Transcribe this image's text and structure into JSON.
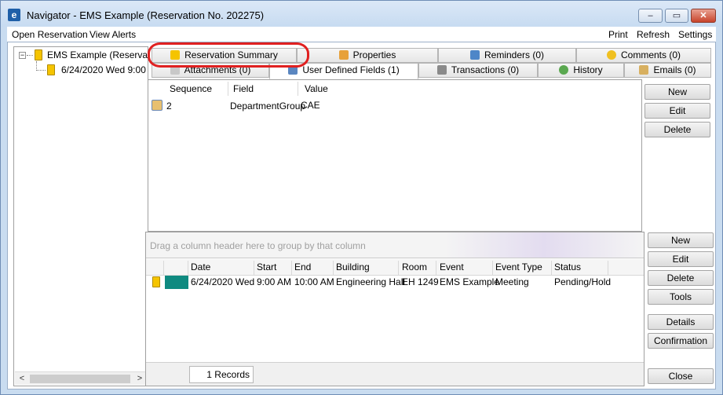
{
  "window": {
    "title": "Navigator - EMS Example (Reservation No. 202275)",
    "icon": "ems-app-icon",
    "controls": {
      "minimize": "–",
      "maximize": "▭",
      "close": "✕"
    }
  },
  "menubar": {
    "left": [
      "Open Reservation",
      "View Alerts"
    ],
    "right": [
      "Print",
      "Refresh",
      "Settings"
    ]
  },
  "tree": {
    "expander": "−",
    "root_label": "EMS Example (Reservatio",
    "child_label": "6/24/2020 Wed 9:00",
    "scroll_left": "<",
    "scroll_right": ">"
  },
  "tabs": {
    "row_top": [
      "Reservation Summary",
      "Properties",
      "Reminders (0)",
      "Comments (0)"
    ],
    "row_bottom": [
      "Attachments (0)",
      "User Defined Fields (1)",
      "Transactions (0)",
      "History",
      "Emails (0)"
    ]
  },
  "udf": {
    "columns": [
      "Sequence",
      "Field",
      "Value"
    ],
    "rows": [
      {
        "sequence": "2",
        "field": "DepartmentGroup",
        "value": "CAE"
      }
    ],
    "buttons": [
      "New",
      "Edit",
      "Delete"
    ]
  },
  "reservations": {
    "group_hint": "Drag a column header here to group by that column",
    "columns": [
      "Date",
      "Start",
      "End",
      "Building",
      "Room",
      "Event",
      "Event Type",
      "Status"
    ],
    "rows": [
      {
        "date": "6/24/2020 Wed",
        "start": "9:00 AM",
        "end": "10:00 AM",
        "building": "Engineering Hall",
        "room": "EH 1249",
        "event": "EMS Example",
        "event_type": "Meeting",
        "status": "Pending/Hold"
      }
    ],
    "records": "1 Records",
    "buttons": [
      "New",
      "Edit",
      "Delete",
      "Tools",
      "Details",
      "Confirmation",
      "Close"
    ],
    "status_color": "#0f8a80"
  },
  "colors": {
    "highlight": "#e02020",
    "window_frame": "#c9dcf0"
  }
}
